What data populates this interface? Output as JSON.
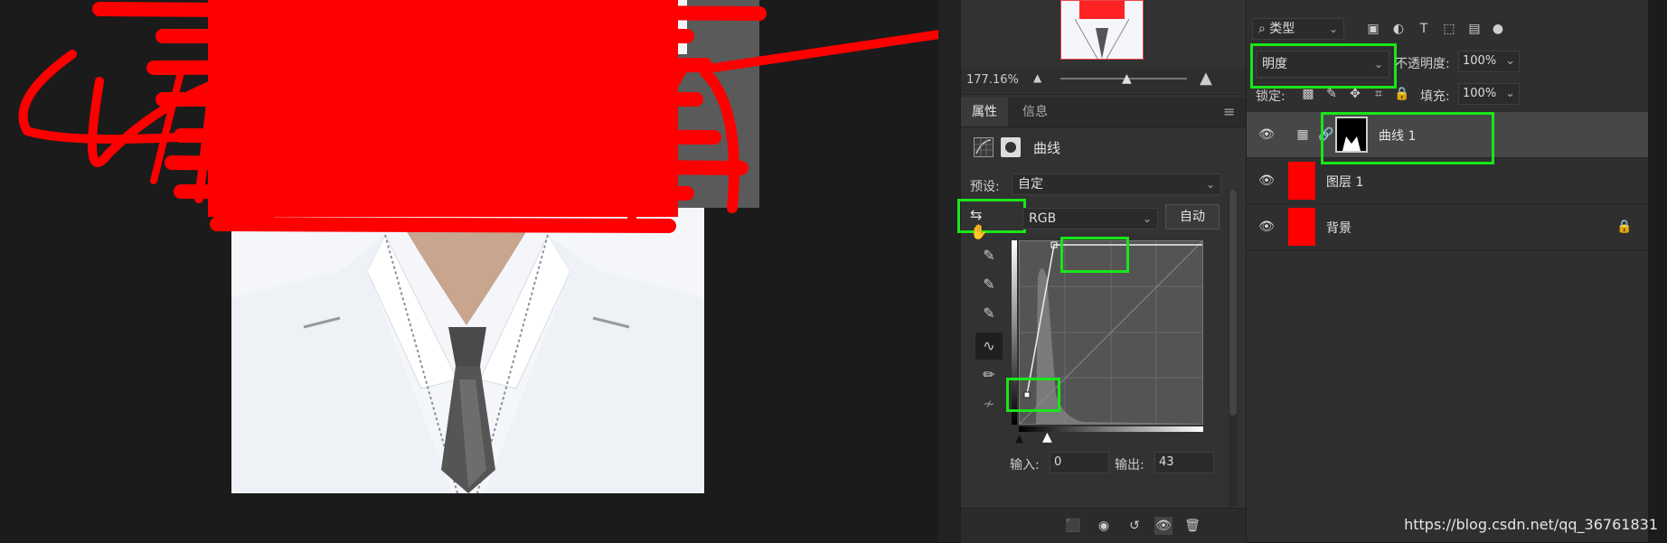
{
  "navigator": {
    "zoom": "177.16%"
  },
  "properties": {
    "tabs": [
      {
        "label": "属性",
        "active": true
      },
      {
        "label": "信息",
        "active": false
      }
    ],
    "adjustment_title": "曲线",
    "preset_label": "预设:",
    "preset_value": "自定",
    "channel_value": "RGB",
    "auto_label": "自动",
    "input_label": "输入:",
    "input_value": "0",
    "output_label": "输出:",
    "output_value": "43"
  },
  "layers_panel": {
    "filter_kind": "类型",
    "blend_mode": "明度",
    "opacity_label": "不透明度:",
    "opacity_value": "100%",
    "lock_label": "锁定:",
    "fill_label": "填充:",
    "fill_value": "100%",
    "layers": [
      {
        "name": "曲线 1",
        "selected": true
      },
      {
        "name": "图层 1",
        "selected": false
      },
      {
        "name": "背景",
        "selected": false
      }
    ]
  },
  "watermark": "https://blog.csdn.net/qq_36761831",
  "colors": {
    "highlight": "#19e619",
    "scribble": "#ff0000"
  }
}
